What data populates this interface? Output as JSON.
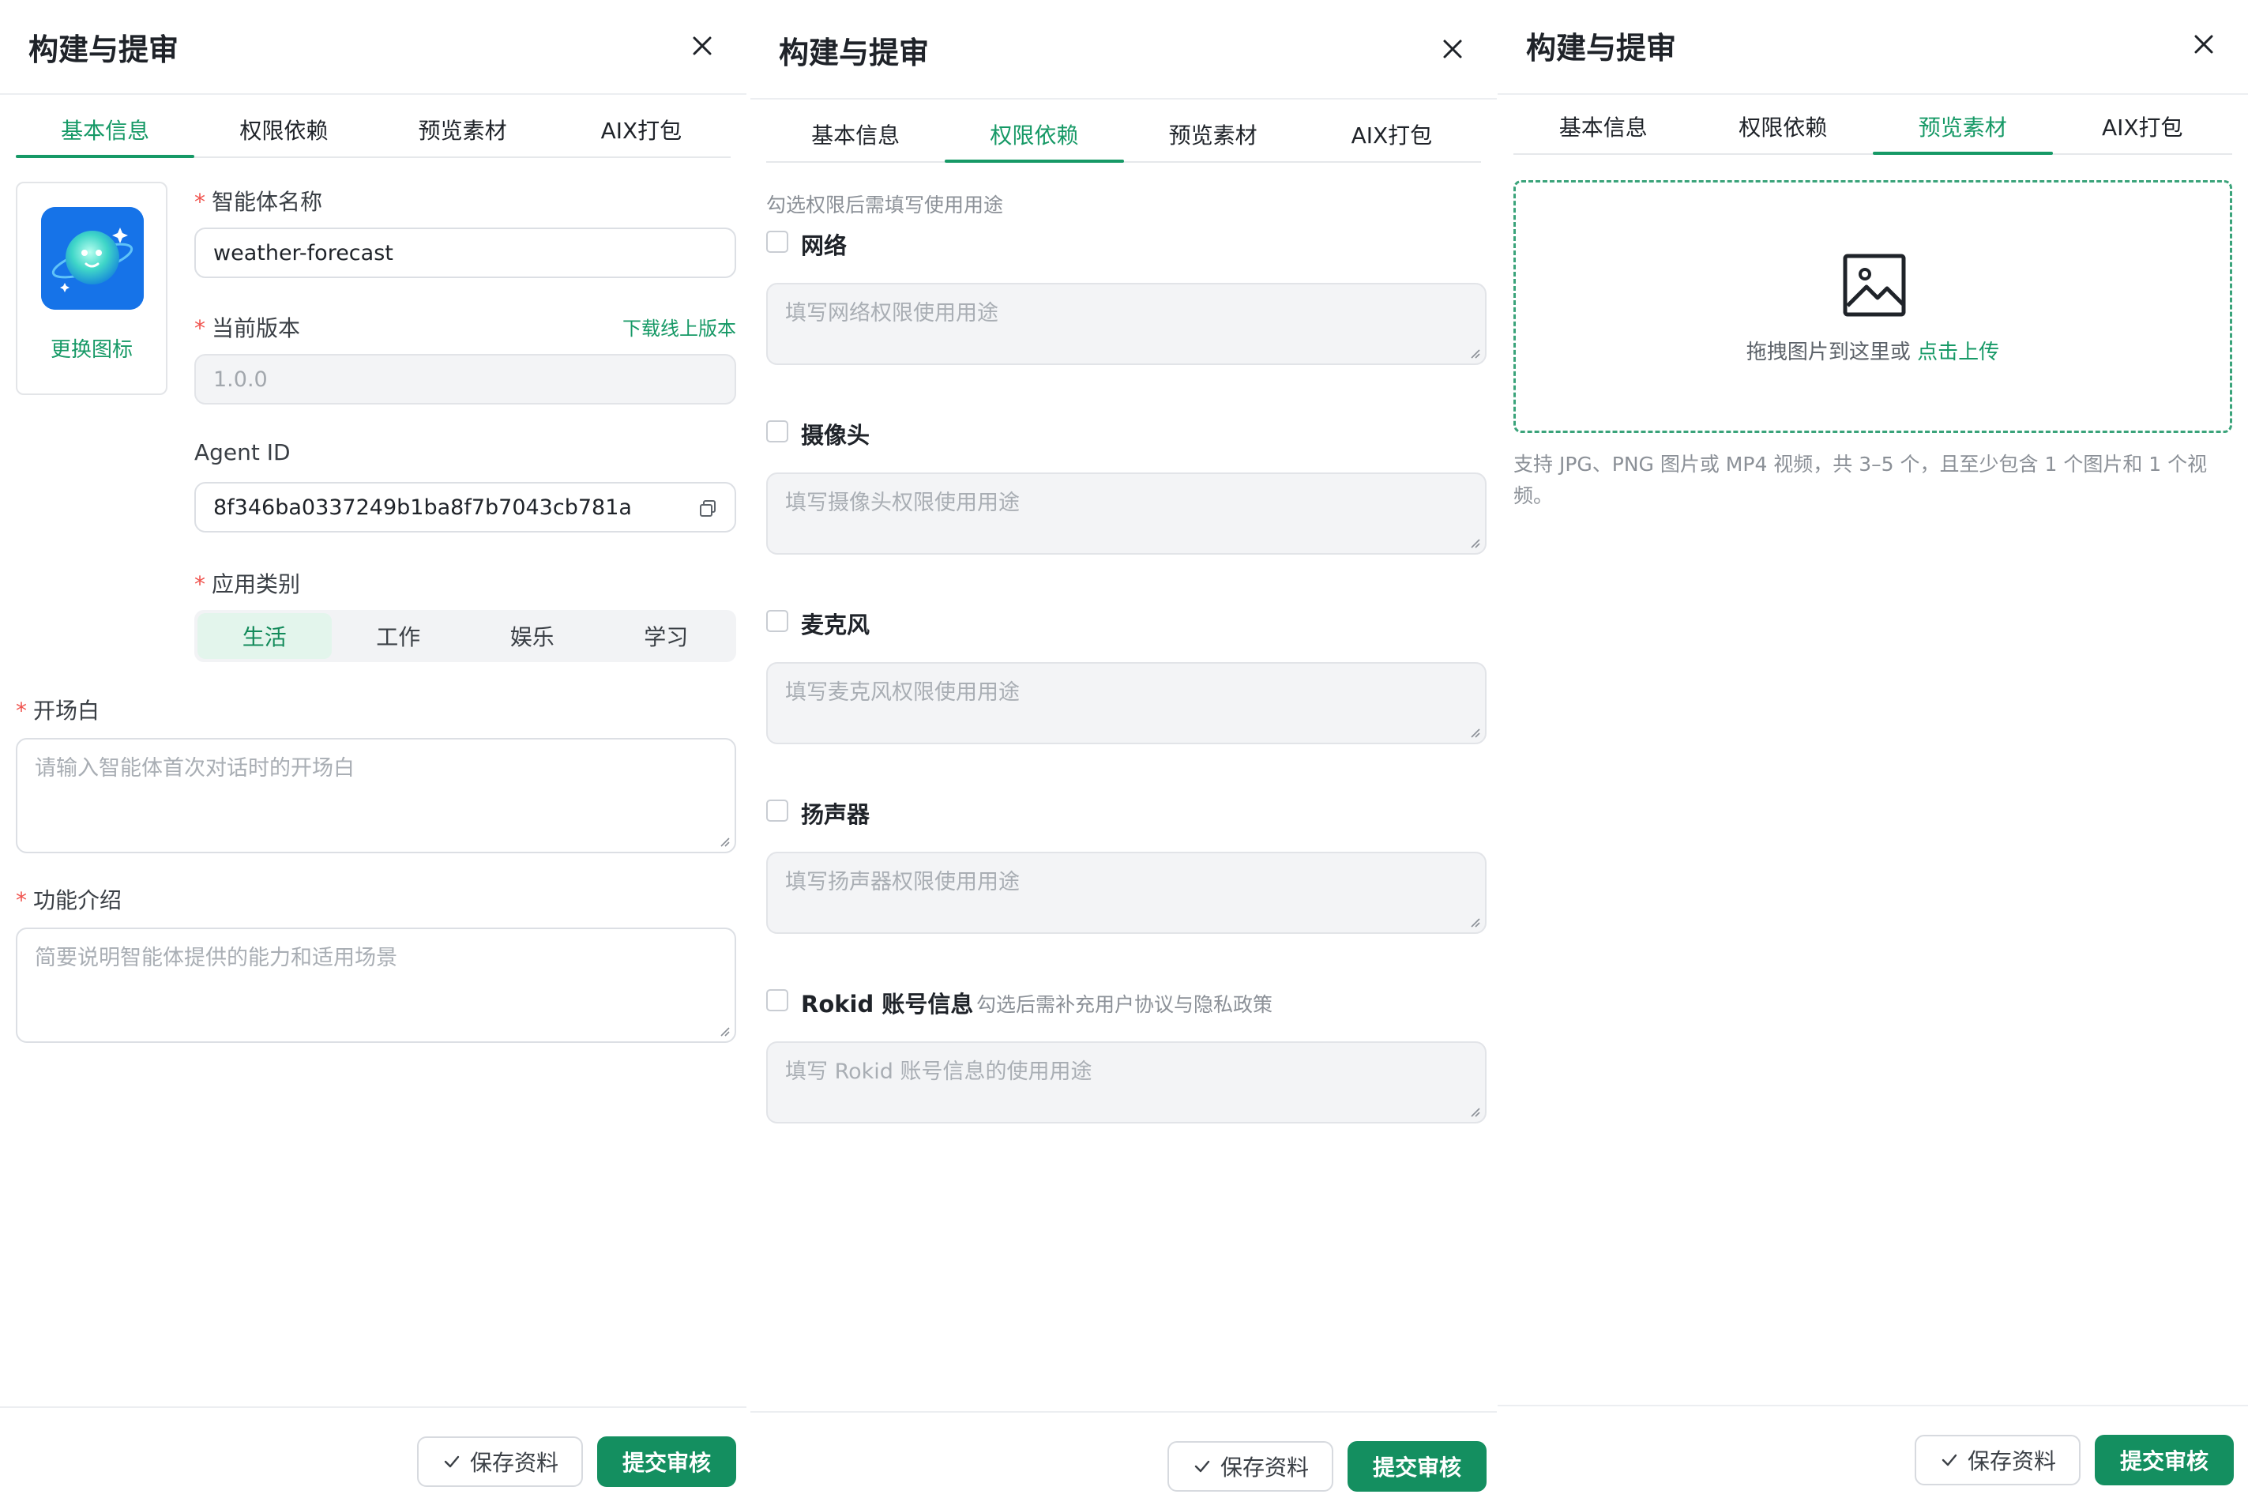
{
  "colors": {
    "accent": "#169966",
    "primary_button": "#148f60",
    "required": "#f0544f"
  },
  "panels": [
    {
      "title": "构建与提审",
      "tabs": [
        "基本信息",
        "权限依赖",
        "预览素材",
        "AIX打包"
      ],
      "active_tab": 0,
      "icon_card": {
        "change_label": "更换图标"
      },
      "fields": {
        "name_label": "智能体名称",
        "name_value": "weather-forecast",
        "version_label": "当前版本",
        "version_link": "下载线上版本",
        "version_value": "1.0.0",
        "agent_id_label": "Agent ID",
        "agent_id_value": "8f346ba0337249b1ba8f7b7043cb781a",
        "category_label": "应用类别",
        "categories": [
          "生活",
          "工作",
          "娱乐",
          "学习"
        ],
        "active_category": "生活",
        "opening_label": "开场白",
        "opening_placeholder": "请输入智能体首次对话时的开场白",
        "intro_label": "功能介绍",
        "intro_placeholder": "简要说明智能体提供的能力和适用场景"
      },
      "footer": {
        "save": "保存资料",
        "submit": "提交审核"
      }
    },
    {
      "title": "构建与提审",
      "tabs": [
        "基本信息",
        "权限依赖",
        "预览素材",
        "AIX打包"
      ],
      "active_tab": 1,
      "hint": "勾选权限后需填写使用用途",
      "permissions": [
        {
          "label": "网络",
          "placeholder": "填写网络权限使用用途",
          "note": ""
        },
        {
          "label": "摄像头",
          "placeholder": "填写摄像头权限使用用途",
          "note": ""
        },
        {
          "label": "麦克风",
          "placeholder": "填写麦克风权限使用用途",
          "note": ""
        },
        {
          "label": "扬声器",
          "placeholder": "填写扬声器权限使用用途",
          "note": ""
        },
        {
          "label": "Rokid 账号信息",
          "placeholder": "填写 Rokid 账号信息的使用用途",
          "note": "勾选后需补充用户协议与隐私政策"
        }
      ],
      "footer": {
        "save": "保存资料",
        "submit": "提交审核"
      }
    },
    {
      "title": "构建与提审",
      "tabs": [
        "基本信息",
        "权限依赖",
        "预览素材",
        "AIX打包"
      ],
      "active_tab": 2,
      "upload": {
        "text": "拖拽图片到这里或",
        "link": "点击上传"
      },
      "support_text": "支持 JPG、PNG 图片或 MP4 视频，共 3–5 个，且至少包含 1 个图片和 1 个视频。",
      "footer": {
        "save": "保存资料",
        "submit": "提交审核"
      }
    }
  ]
}
